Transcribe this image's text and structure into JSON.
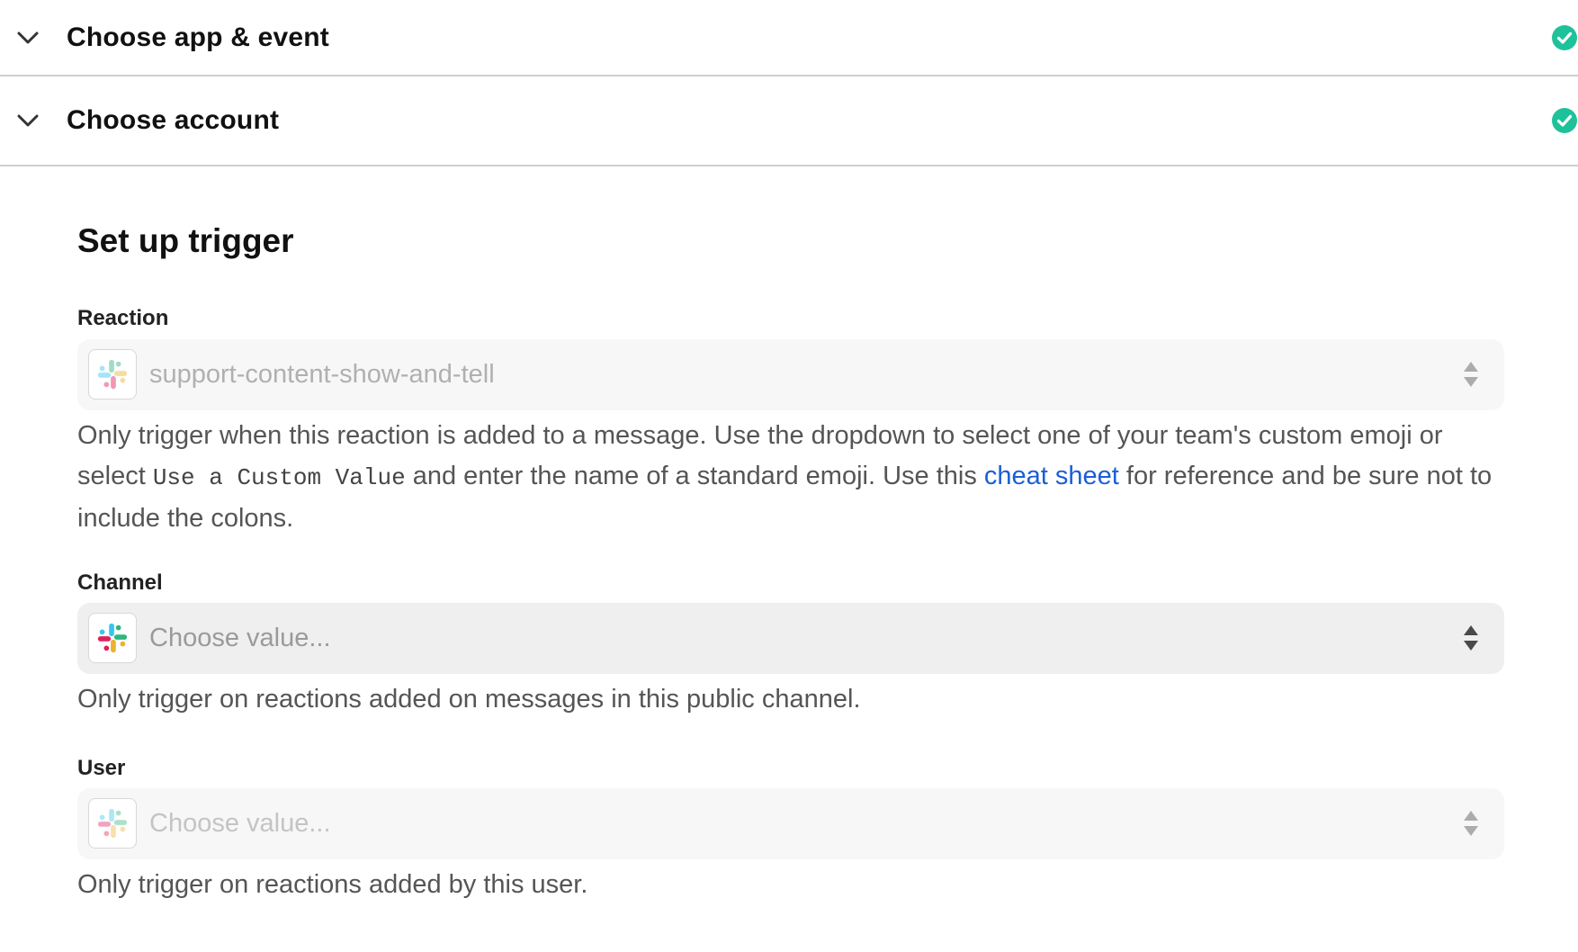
{
  "sections": [
    {
      "title": "Choose app & event",
      "complete": true
    },
    {
      "title": "Choose account",
      "complete": true
    }
  ],
  "setup": {
    "heading": "Set up trigger",
    "fields": {
      "reaction": {
        "label": "Reaction",
        "value": "support-content-show-and-tell",
        "help_1": "Only trigger when this reaction is added to a message. Use the dropdown to select one of your team's custom emoji or select ",
        "help_code": "Use a Custom Value",
        "help_2": " and enter the name of a standard emoji. Use this ",
        "help_link": "cheat sheet",
        "help_3": " for reference and be sure not to include the colons."
      },
      "channel": {
        "label": "Channel",
        "placeholder": "Choose value...",
        "help": "Only trigger on reactions added on messages in this public channel."
      },
      "user": {
        "label": "User",
        "placeholder": "Choose value...",
        "help": "Only trigger on reactions added by this user."
      }
    }
  },
  "icons": {
    "section_toggle": "chevron-down-icon",
    "complete": "check-circle-icon",
    "app": "slack-icon",
    "dropdown": "sort-arrows-icon"
  },
  "colors": {
    "complete_green": "#1ec29a",
    "link_blue": "#1a5fd6",
    "slack_blue": "#36c5f0",
    "slack_green": "#2eb67d",
    "slack_yellow": "#ecb22e",
    "slack_red": "#e01e5a"
  }
}
